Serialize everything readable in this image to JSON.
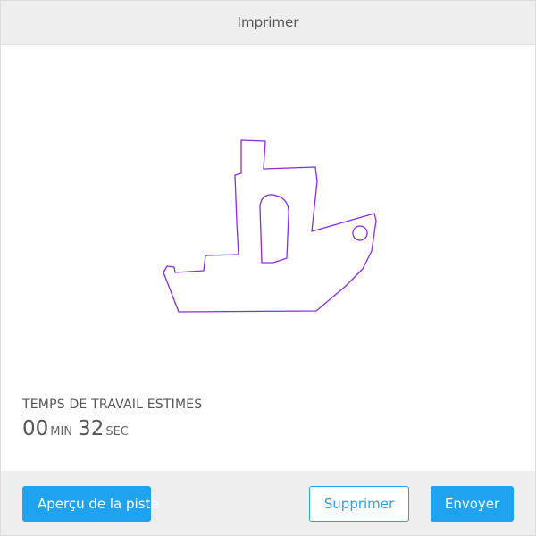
{
  "dialog": {
    "title": "Imprimer"
  },
  "preview": {
    "object_icon": "boat-outline-icon",
    "stroke_color": "#8a2be2"
  },
  "estimate": {
    "label": "TEMPS DE TRAVAIL ESTIMES",
    "minutes": "00",
    "minutes_unit": "MIN",
    "seconds": "32",
    "seconds_unit": "SEC"
  },
  "footer": {
    "preview_button": "Aperçu de la piste",
    "delete_button": "Supprimer",
    "send_button": "Envoyer"
  },
  "colors": {
    "accent": "#1fa3f0",
    "header_bg": "#eeeeee"
  }
}
